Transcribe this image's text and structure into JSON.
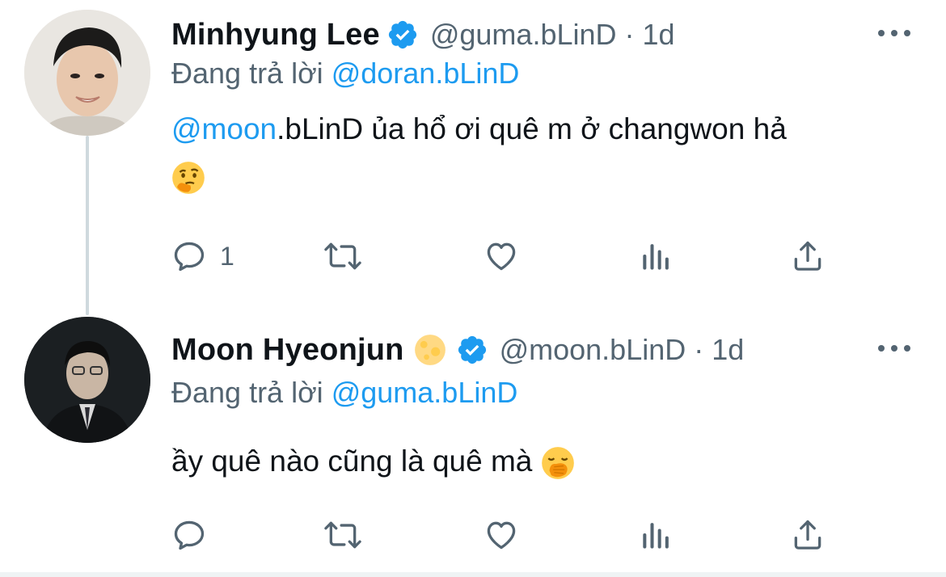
{
  "tweets": [
    {
      "display_name": "Minhyung Lee",
      "handle": "@guma.bLinD",
      "separator": "·",
      "time": "1d",
      "reply_prefix": "Đang trả lời",
      "reply_handle": "@doran.bLinD",
      "mention": "@moon",
      "text": ".bLinD ủa hổ ơi quê m ở changwon hả",
      "emoji": "thinking-face",
      "reply_count": "1",
      "colors": {
        "accent": "#1d9bf0",
        "verified": "#1d9bf0"
      }
    },
    {
      "display_name": "Moon Hyeonjun",
      "name_emoji": "full-moon",
      "handle": "@moon.bLinD",
      "separator": "·",
      "time": "1d",
      "reply_prefix": "Đang trả lời",
      "reply_handle": "@guma.bLinD",
      "text": "ầy quê nào cũng là quê mà",
      "emoji": "face-with-hand-over-mouth",
      "reply_count": ""
    }
  ],
  "icons": [
    "reply-icon",
    "retweet-icon",
    "like-icon",
    "views-icon",
    "share-icon",
    "more-icon",
    "verified-badge-icon"
  ]
}
